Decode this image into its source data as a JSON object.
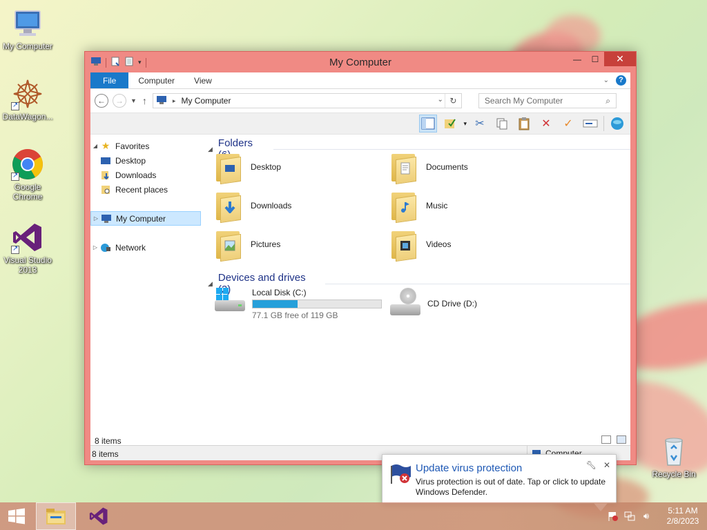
{
  "desktop": {
    "icons": [
      {
        "label": "My Computer"
      },
      {
        "label": "DataWagon..."
      },
      {
        "label": "Google Chrome"
      },
      {
        "label": "Visual Studio 2013"
      },
      {
        "label": "Recycle Bin"
      }
    ]
  },
  "window": {
    "title": "My Computer",
    "tabs": [
      {
        "label": "File"
      },
      {
        "label": "Computer"
      },
      {
        "label": "View"
      }
    ],
    "address": {
      "path": "My Computer"
    },
    "search": {
      "placeholder": "Search My Computer"
    },
    "toolbar": {
      "icons": [
        "preview-pane-icon",
        "properties-icon",
        "cut-icon",
        "copy-icon",
        "paste-icon",
        "delete-icon",
        "check-icon",
        "rename-icon",
        "network-globe-icon"
      ]
    },
    "navpane": {
      "favorites": {
        "label": "Favorites",
        "items": [
          {
            "label": "Desktop"
          },
          {
            "label": "Downloads"
          },
          {
            "label": "Recent places"
          }
        ]
      },
      "computer": {
        "label": "My Computer"
      },
      "network": {
        "label": "Network"
      }
    },
    "folders_group": {
      "label": "Folders (6)"
    },
    "folders": [
      {
        "label": "Desktop",
        "icon": "desktop-folder-icon"
      },
      {
        "label": "Documents",
        "icon": "documents-folder-icon"
      },
      {
        "label": "Downloads",
        "icon": "downloads-folder-icon"
      },
      {
        "label": "Music",
        "icon": "music-folder-icon"
      },
      {
        "label": "Pictures",
        "icon": "pictures-folder-icon"
      },
      {
        "label": "Videos",
        "icon": "videos-folder-icon"
      }
    ],
    "drives_group": {
      "label": "Devices and drives (2)"
    },
    "drives": [
      {
        "label": "Local Disk (C:)",
        "free_text": "77.1 GB free of 119 GB",
        "used_fraction": 0.352
      },
      {
        "label": "CD Drive (D:)"
      }
    ],
    "details": {
      "count": "8 items"
    },
    "status": {
      "count": "8 items",
      "location": "Computer"
    }
  },
  "notification": {
    "title": "Update virus protection",
    "body": "Virus protection is out of date. Tap or click to update Windows Defender."
  },
  "taskbar": {
    "time": "5:11 AM",
    "date": "2/8/2023"
  },
  "colors": {
    "window_frame": "#f08a84",
    "close_button": "#c7403a",
    "accent": "#1979ca",
    "group_header": "#1e3287",
    "usage_fill": "#26a0da",
    "notification_title": "#1f59b5"
  }
}
